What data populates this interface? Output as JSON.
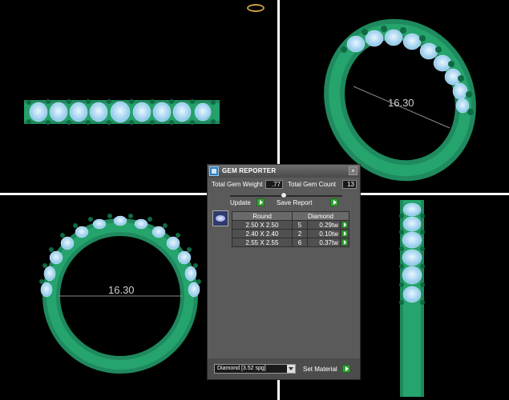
{
  "viewports": {
    "top_right": {
      "dimension": "16.30"
    },
    "bottom_left": {
      "dimension": "16.30"
    }
  },
  "panel": {
    "title": "GEM REPORTER",
    "close": "×",
    "total_gem_weight_label": "Total Gem Weight",
    "total_gem_weight": ".77",
    "total_gem_count_label": "Total Gem Count",
    "total_gem_count": "13",
    "update_label": "Update",
    "save_report_label": "Save Report",
    "table": {
      "headers": [
        "Round",
        "Diamond"
      ],
      "rows": [
        {
          "size": "2.50 X 2.50",
          "qty": "5",
          "weight": "0.29tw"
        },
        {
          "size": "2.40 X 2.40",
          "qty": "2",
          "weight": "0.10tw"
        },
        {
          "size": "2.55 X 2.55",
          "qty": "6",
          "weight": "0.37tw"
        }
      ]
    },
    "material_selected": "Diamond   [3.52 spg]",
    "set_material_label": "Set Material"
  },
  "colors": {
    "metal_green": "#1e8a5e",
    "gem_blue": "#a8d8f0",
    "accent_green": "#35a335"
  }
}
